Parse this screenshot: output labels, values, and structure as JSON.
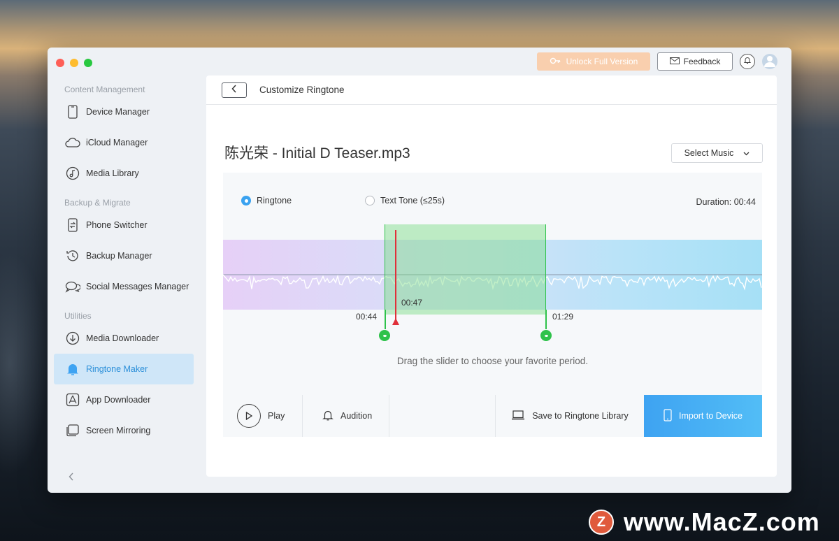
{
  "titlebar": {
    "unlock_label": "Unlock Full Version",
    "feedback_label": "Feedback"
  },
  "sidebar": {
    "sections": [
      {
        "title": "Content Management"
      },
      {
        "title": "Backup & Migrate"
      },
      {
        "title": "Utilities"
      }
    ],
    "items": [
      {
        "label": "Device Manager",
        "icon": "phone-icon"
      },
      {
        "label": "iCloud Manager",
        "icon": "cloud-icon"
      },
      {
        "label": "Media Library",
        "icon": "music-icon"
      },
      {
        "label": "Phone Switcher",
        "icon": "switch-icon"
      },
      {
        "label": "Backup Manager",
        "icon": "history-icon"
      },
      {
        "label": "Social Messages Manager",
        "icon": "chat-icon"
      },
      {
        "label": "Media Downloader",
        "icon": "download-icon"
      },
      {
        "label": "Ringtone Maker",
        "icon": "bell-icon",
        "active": true
      },
      {
        "label": "App Downloader",
        "icon": "app-store-icon"
      },
      {
        "label": "Screen Mirroring",
        "icon": "mirror-icon"
      }
    ]
  },
  "main": {
    "title": "Customize Ringtone",
    "song_title": "陈光荣 - Initial D Teaser.mp3",
    "select_music_label": "Select Music",
    "radio": {
      "ringtone_label": "Ringtone",
      "text_tone_label": "Text Tone (≤25s)",
      "selected": "Ringtone"
    },
    "duration_label": "Duration: 00:44",
    "start_time": "00:44",
    "current_time": "00:47",
    "end_time": "01:29",
    "hint": "Drag the slider to choose your favorite period.",
    "actions": {
      "play_label": "Play",
      "audition_label": "Audition",
      "save_label": "Save to Ringtone Library",
      "import_label": "Import to Device"
    }
  },
  "colors": {
    "accent": "#3aa2f0",
    "selection": "#2ec24a",
    "playhead": "#e0303a",
    "unlock": "#f9cfae"
  },
  "watermark": {
    "logo_letter": "Z",
    "text": "www.MacZ.com"
  }
}
